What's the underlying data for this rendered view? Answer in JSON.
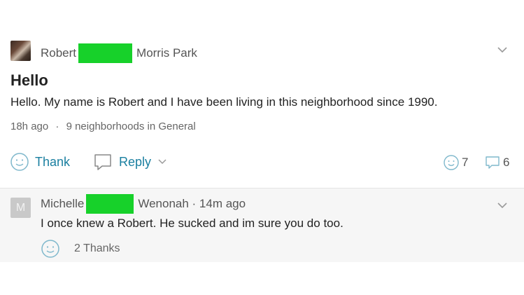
{
  "post": {
    "author": "Robert",
    "neighborhood": "Morris Park",
    "title": "Hello",
    "body": "Hello. My name is Robert and I have been living in this neighborhood since 1990.",
    "time": "18h ago",
    "meta_separator": "·",
    "scope": "9 neighborhoods in General",
    "thank_label": "Thank",
    "reply_label": "Reply",
    "thanks_count": "7",
    "replies_count": "6"
  },
  "reply": {
    "avatar_letter": "M",
    "author": "Michelle",
    "neighborhood_and_time": "Wenonah · 14m ago",
    "body": "I once knew a Robert. He sucked and im sure you do too.",
    "thanks_label": "2 Thanks"
  },
  "colors": {
    "redaction": "#17d12a",
    "action_link": "#1a7fa0"
  },
  "icons": [
    "smiley-icon",
    "speech-bubble-icon",
    "chevron-down-icon"
  ]
}
